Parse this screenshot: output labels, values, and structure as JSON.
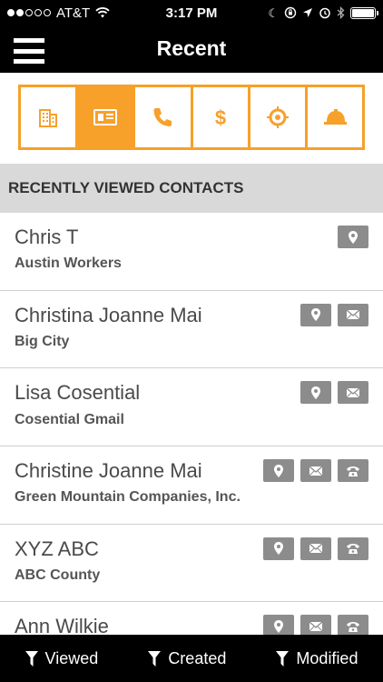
{
  "status": {
    "carrier": "AT&T",
    "time": "3:17 PM",
    "signal_filled": 2,
    "signal_total": 5
  },
  "nav": {
    "title": "Recent",
    "menu_icon": "hamburger-menu-icon"
  },
  "tabs": [
    {
      "name": "companies",
      "icon": "building-icon",
      "active": false
    },
    {
      "name": "contacts",
      "icon": "contact-card-icon",
      "active": true
    },
    {
      "name": "calls",
      "icon": "phone-icon",
      "active": false
    },
    {
      "name": "opportunities",
      "icon": "dollar-icon",
      "active": false
    },
    {
      "name": "leads",
      "icon": "target-icon",
      "active": false
    },
    {
      "name": "projects",
      "icon": "hard-hat-icon",
      "active": false
    }
  ],
  "section": {
    "title": "RECENTLY VIEWED CONTACTS"
  },
  "contacts": [
    {
      "name": "Chris T",
      "company": "Austin Workers",
      "actions": [
        "map"
      ]
    },
    {
      "name": "Christina Joanne Mai",
      "company": "Big City",
      "actions": [
        "map",
        "email"
      ]
    },
    {
      "name": "Lisa Cosential",
      "company": "Cosential Gmail",
      "actions": [
        "map",
        "email"
      ]
    },
    {
      "name": "Christine Joanne Mai",
      "company": "Green Mountain Companies, Inc.",
      "actions": [
        "map",
        "email",
        "phone"
      ]
    },
    {
      "name": "XYZ ABC",
      "company": "ABC County",
      "actions": [
        "map",
        "email",
        "phone"
      ]
    },
    {
      "name": "Ann Wilkie",
      "company": "",
      "actions": [
        "map",
        "email",
        "phone"
      ]
    }
  ],
  "filters": [
    {
      "label": "Viewed"
    },
    {
      "label": "Created"
    },
    {
      "label": "Modified"
    }
  ],
  "colors": {
    "accent": "#f7a02a",
    "bar": "#000000",
    "action_button": "#8c8c8c",
    "section_bg": "#d9d9d9"
  }
}
